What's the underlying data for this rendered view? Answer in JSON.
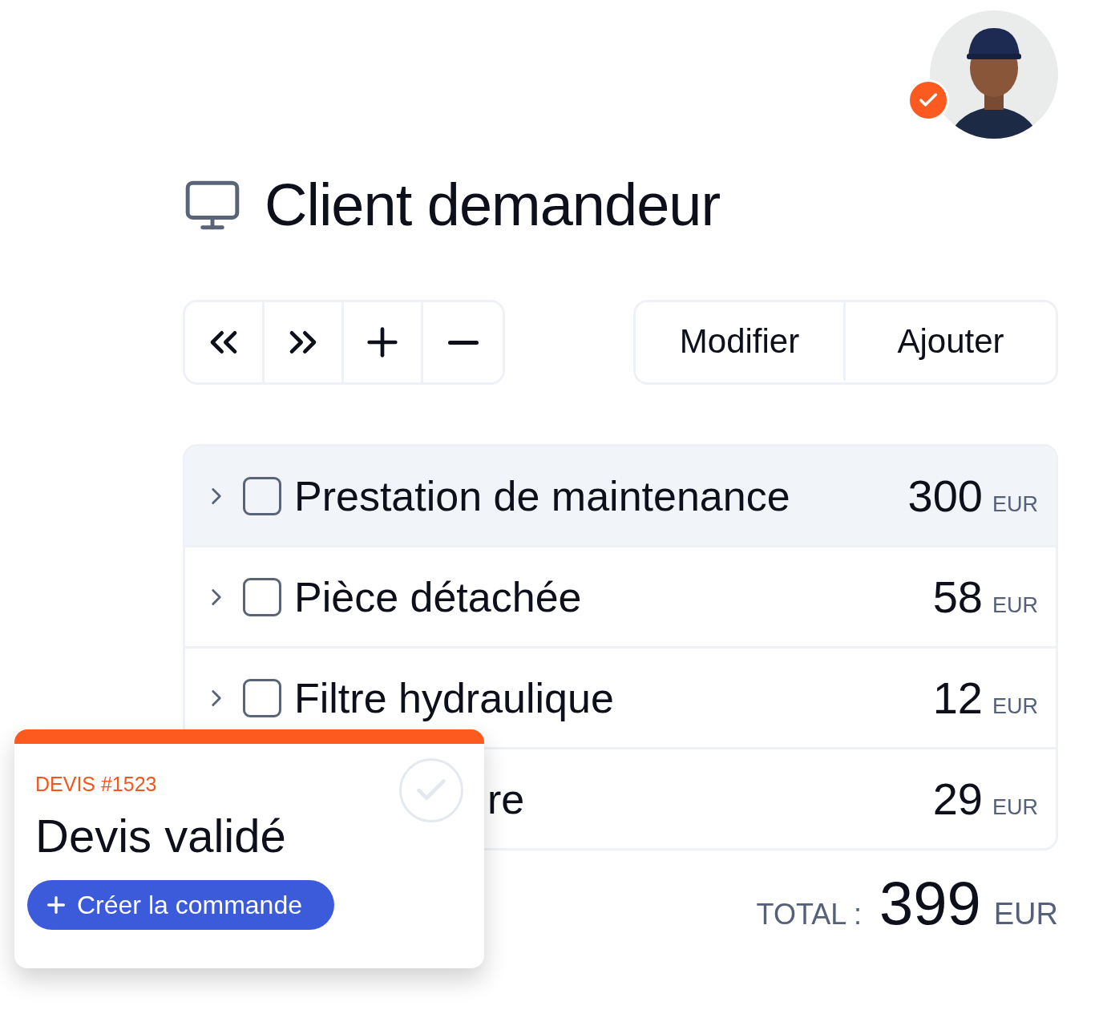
{
  "avatar": {
    "verified": true
  },
  "header": {
    "title": "Client demandeur"
  },
  "actions": [
    "Modifier",
    "Ajouter"
  ],
  "items": [
    {
      "kind": "full",
      "label": "Prestation de maintenance",
      "amount": "300",
      "currency": "EUR",
      "selected": true,
      "checked": false
    },
    {
      "kind": "full",
      "label": "Pièce détachée",
      "amount": "58",
      "currency": "EUR",
      "selected": false,
      "checked": false
    },
    {
      "kind": "full",
      "label": "Filtre hydraulique",
      "amount": "12",
      "currency": "EUR",
      "selected": false,
      "checked": false
    },
    {
      "kind": "partial",
      "label": "re",
      "amount": "29",
      "currency": "EUR",
      "selected": false
    }
  ],
  "total": {
    "label": "TOTAL :",
    "amount": "399",
    "currency": "EUR"
  },
  "card": {
    "ref": "DEVIS #1523",
    "title": "Devis validé",
    "button": "Créer la commande",
    "validated": true
  }
}
